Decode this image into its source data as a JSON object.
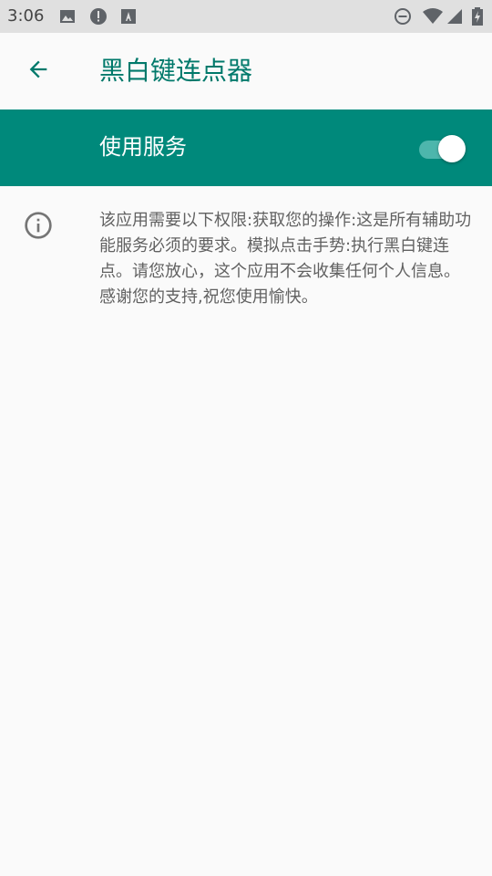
{
  "status_bar": {
    "time": "3:06",
    "icons": [
      "image-icon",
      "alert-icon",
      "font-icon"
    ],
    "right_icons": [
      "dnd-icon",
      "wifi-icon",
      "signal-icon",
      "battery-charging-icon"
    ]
  },
  "toolbar": {
    "title": "黑白键连点器",
    "back_icon": "arrow-left-icon"
  },
  "service": {
    "label": "使用服务",
    "enabled": true
  },
  "info": {
    "icon": "info-icon",
    "text": "该应用需要以下权限:获取您的操作:这是所有辅助功能服务必须的要求。模拟点击手势:执行黑白键连点。请您放心，这个应用不会收集任何个人信息。感谢您的支持,祝您使用愉快。"
  },
  "colors": {
    "primary": "#00897b",
    "primary_dark_text": "#00796b",
    "switch_track": "#4db6ac",
    "background": "#fafafa",
    "status_bar": "#e0e0e0"
  }
}
